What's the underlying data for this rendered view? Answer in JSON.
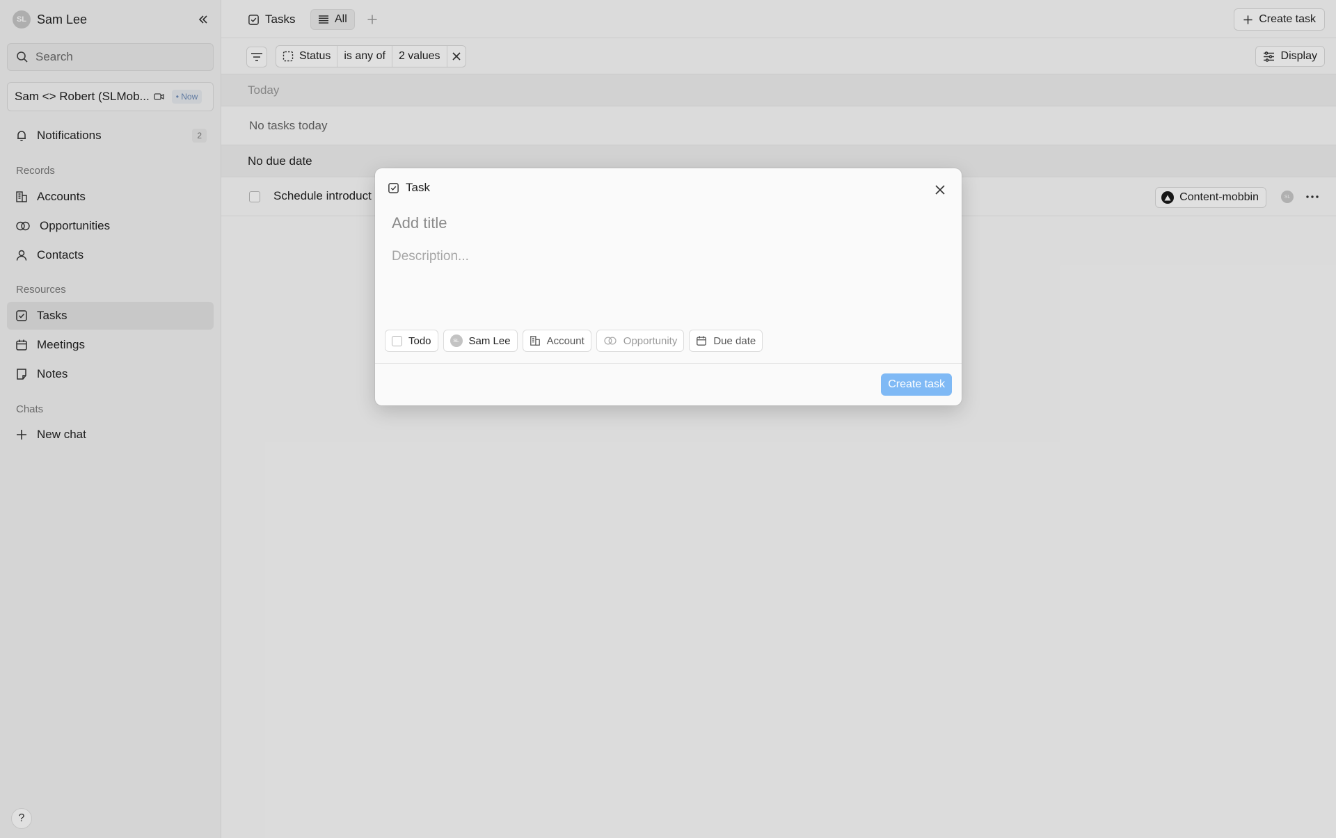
{
  "sidebar": {
    "avatar_initials": "SL",
    "user_name": "Sam Lee",
    "search_placeholder": "Search",
    "meeting": {
      "title": "Sam <> Robert (SLMob...",
      "badge": "• Now"
    },
    "notifications": {
      "label": "Notifications",
      "count": "2"
    },
    "records_label": "Records",
    "records": [
      {
        "label": "Accounts",
        "icon": "building-icon"
      },
      {
        "label": "Opportunities",
        "icon": "rings-icon"
      },
      {
        "label": "Contacts",
        "icon": "person-icon"
      }
    ],
    "resources_label": "Resources",
    "resources": [
      {
        "label": "Tasks",
        "icon": "checkbox-icon",
        "active": true
      },
      {
        "label": "Meetings",
        "icon": "calendar-icon"
      },
      {
        "label": "Notes",
        "icon": "note-icon"
      }
    ],
    "chats_label": "Chats",
    "new_chat_label": "New chat",
    "help_label": "?"
  },
  "topbar": {
    "tasks_tab": "Tasks",
    "all_tab": "All",
    "create_task_label": "Create task"
  },
  "filterbar": {
    "field": "Status",
    "operator": "is any of",
    "value": "2 values",
    "display_label": "Display"
  },
  "list": {
    "groups": [
      {
        "label": "Today",
        "empty_text": "No tasks today"
      },
      {
        "label": "No due date"
      }
    ],
    "task": {
      "title": "Schedule introduct",
      "tag": "Content-mobbin",
      "assignee_initials": "SL"
    }
  },
  "modal": {
    "header": "Task",
    "title_placeholder": "Add title",
    "description_placeholder": "Description...",
    "pills": {
      "status": "Todo",
      "assignee": "Sam Lee",
      "assignee_initials": "SL",
      "account": "Account",
      "opportunity": "Opportunity",
      "due_date": "Due date"
    },
    "create_label": "Create task"
  },
  "colors": {
    "accent": "#7fb9f5",
    "sidebar_bg": "#f3f3f3",
    "active_nav_bg": "#e4e4e4"
  }
}
